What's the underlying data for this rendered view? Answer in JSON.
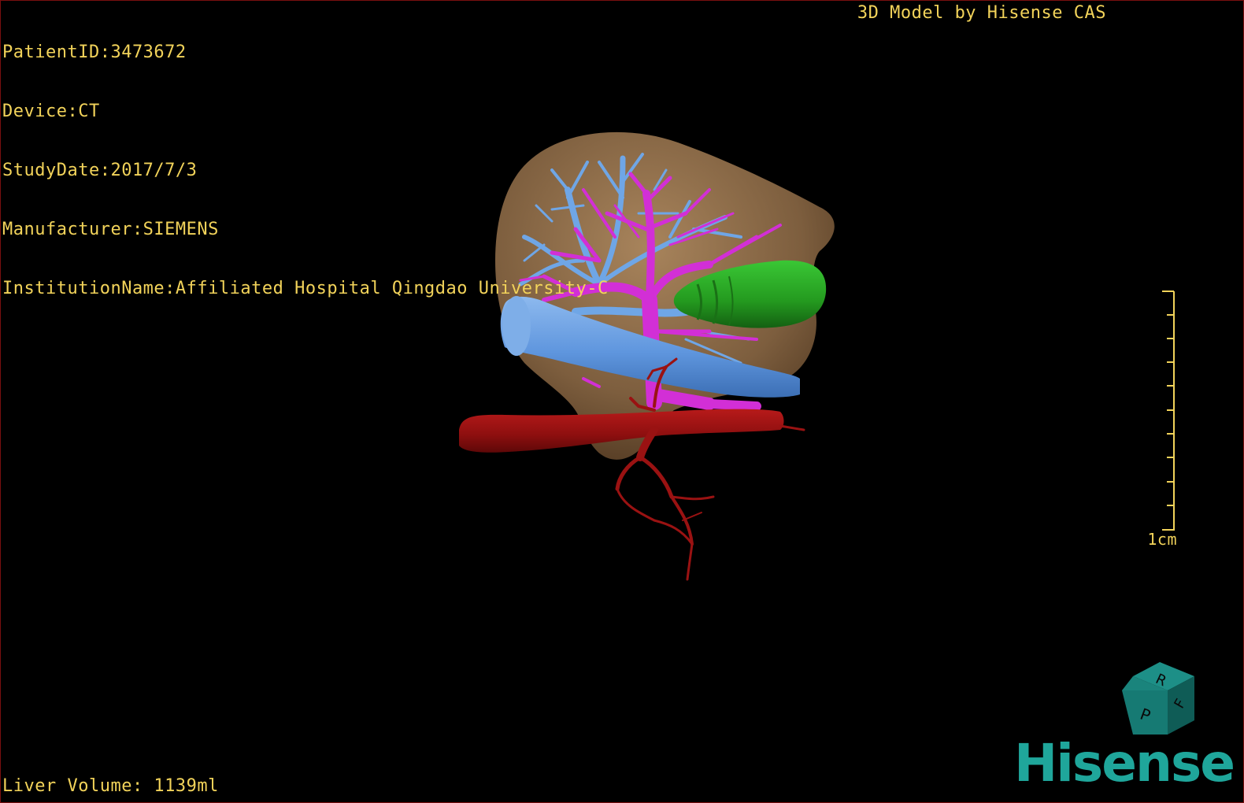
{
  "header": {
    "patient_id": "PatientID:3473672",
    "device": "Device:CT",
    "study_date": "StudyDate:2017/7/3",
    "manufacturer": "Manufacturer:SIEMENS",
    "institution": "InstitutionName:Affiliated Hospital Qingdao University-C"
  },
  "brand_caption": "3D Model by Hisense CAS",
  "footer": {
    "liver_volume": "Liver Volume: 1139ml"
  },
  "scale": {
    "label": "1cm"
  },
  "orientation_cube": {
    "faces": [
      "R",
      "F",
      "P"
    ],
    "color": "#167a73"
  },
  "logo": {
    "text": "Hisense",
    "color": "#1fa69b"
  },
  "colors": {
    "overlay_text": "#f2d35a",
    "liver": "#8a6a48",
    "portal_vein": "#d22fd6",
    "hepatic_vein": "#6fa6e6",
    "inferior_vena_cava": "#5f96de",
    "artery": "#9a1212",
    "tumor_green": "#2aa024",
    "border": "#7a0f0f"
  }
}
